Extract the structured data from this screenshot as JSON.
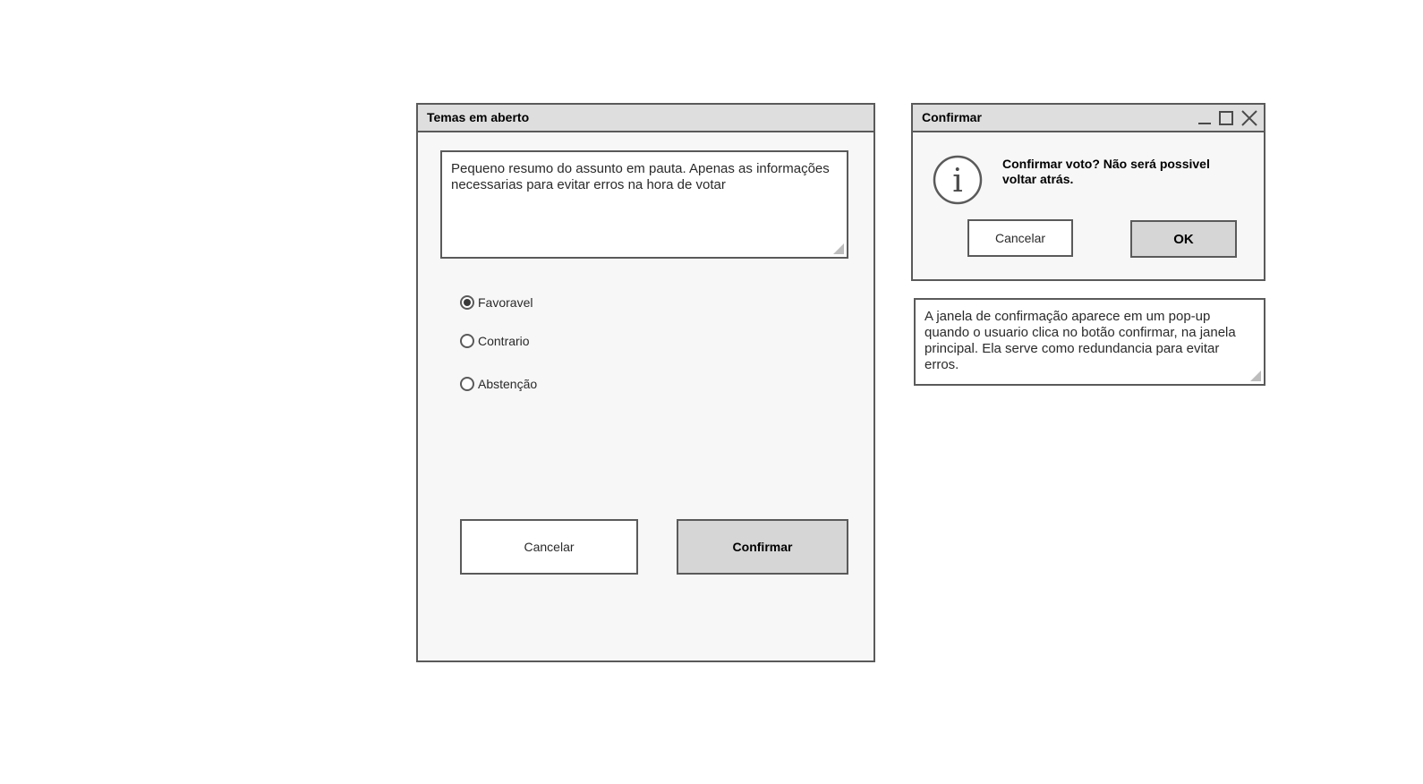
{
  "main_window": {
    "title": "Temas em aberto",
    "summary_text": "Pequeno resumo do assunto em pauta. Apenas as informações necessarias para evitar erros na hora de votar",
    "options": [
      {
        "label": "Favoravel",
        "selected": true
      },
      {
        "label": "Contrario",
        "selected": false
      },
      {
        "label": "Abstenção",
        "selected": false
      }
    ],
    "cancel_label": "Cancelar",
    "confirm_label": "Confirmar"
  },
  "confirm_window": {
    "title": "Confirmar",
    "message": "Confirmar voto? Não será possivel voltar atrás.",
    "cancel_label": "Cancelar",
    "ok_label": "OK",
    "icon": "info-icon"
  },
  "note": {
    "text": "A janela de confirmação aparece em um pop-up quando o usuario clica no botão confirmar, na janela principal. Ela serve como redundancia para evitar erros."
  },
  "colors": {
    "border": "#5a5a5a",
    "titlebar_bg": "#dedede",
    "window_bg": "#f7f7f7",
    "primary_button_bg": "#d6d6d6"
  }
}
